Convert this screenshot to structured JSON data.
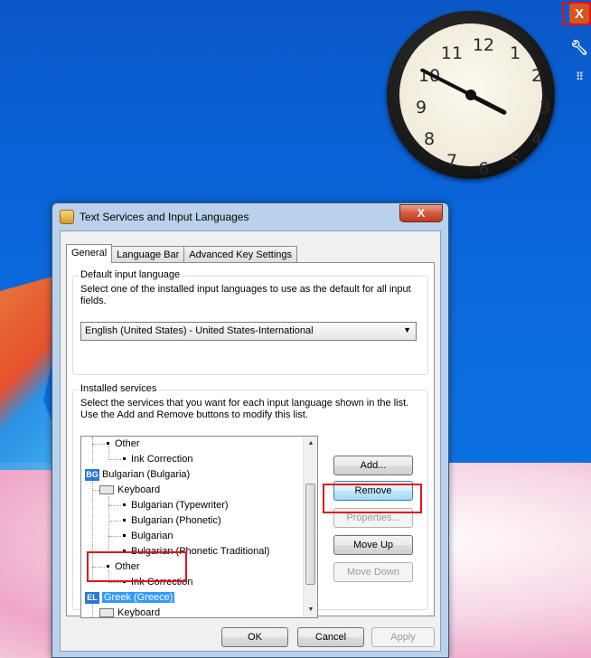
{
  "desktop": {
    "clock": {
      "numbers": [
        "12",
        "1",
        "2",
        "3",
        "4",
        "5",
        "6",
        "7",
        "8",
        "9",
        "10",
        "11"
      ]
    },
    "gadget_controls": {
      "close_glyph": "X",
      "options_icon": "wrench-icon",
      "drag_icon": "grip-icon"
    }
  },
  "dialog": {
    "title": "Text Services and Input Languages",
    "close_glyph": "X",
    "tabs": [
      "General",
      "Language Bar",
      "Advanced Key Settings"
    ],
    "default_group": {
      "label": "Default input language",
      "description": "Select one of the installed input languages to use as the default for all input fields.",
      "selected": "English (United States) - United States-International"
    },
    "services_group": {
      "label": "Installed services",
      "description": "Select the services that you want for each input language shown in the list. Use the Add and Remove buttons to modify this list.",
      "tree": [
        {
          "text": "Other",
          "level": 1
        },
        {
          "text": "Ink Correction",
          "level": 2
        },
        {
          "badge": "BG",
          "text": "Bulgarian (Bulgaria)",
          "level": 0
        },
        {
          "text": "Keyboard",
          "level": 1
        },
        {
          "text": "Bulgarian (Typewriter)",
          "level": 2
        },
        {
          "text": "Bulgarian (Phonetic)",
          "level": 2
        },
        {
          "text": "Bulgarian",
          "level": 2
        },
        {
          "text": "Bulgarian (Phonetic Traditional)",
          "level": 2
        },
        {
          "text": "Other",
          "level": 1
        },
        {
          "text": "Ink Correction",
          "level": 2
        },
        {
          "badge": "EL",
          "text": "Greek (Greece)",
          "level": 0,
          "selected": true
        },
        {
          "text": "Keyboard",
          "level": 1
        }
      ],
      "buttons": {
        "add": "Add...",
        "remove": "Remove",
        "properties": "Properties...",
        "move_up": "Move Up",
        "move_down": "Move Down"
      }
    },
    "footer": {
      "ok": "OK",
      "cancel": "Cancel",
      "apply": "Apply"
    }
  },
  "colors": {
    "highlight": "#e0141b",
    "selection": "#3399ff"
  }
}
